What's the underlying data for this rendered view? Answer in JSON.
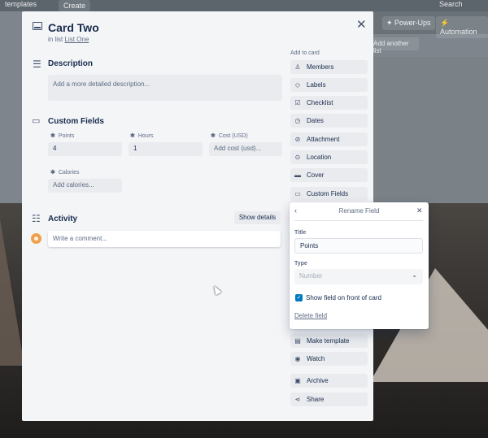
{
  "background": {
    "top_items": [
      "templates",
      "Create",
      "Search"
    ],
    "header_buttons": [
      "Power-Ups",
      "Automation"
    ],
    "add_list": "Add another list"
  },
  "card": {
    "title": "Card Two",
    "in_list_prefix": "in list",
    "list_name": "List One"
  },
  "description": {
    "title": "Description",
    "placeholder": "Add a more detailed description..."
  },
  "custom_fields": {
    "title": "Custom Fields",
    "fields": [
      {
        "label": "Points",
        "value": "4",
        "placeholder": false
      },
      {
        "label": "Hours",
        "value": "1",
        "placeholder": false
      },
      {
        "label": "Cost (USD)",
        "value": "Add cost (usd)...",
        "placeholder": true
      },
      {
        "label": "Calories",
        "value": "Add calories...",
        "placeholder": true
      }
    ]
  },
  "activity": {
    "title": "Activity",
    "show_details": "Show details",
    "comment_placeholder": "Write a comment..."
  },
  "sidebar": {
    "heading": "Add to card",
    "items": [
      {
        "label": "Members",
        "icon": "person-icon"
      },
      {
        "label": "Labels",
        "icon": "tag-icon"
      },
      {
        "label": "Checklist",
        "icon": "checklist-icon"
      },
      {
        "label": "Dates",
        "icon": "clock-icon"
      },
      {
        "label": "Attachment",
        "icon": "paperclip-icon"
      },
      {
        "label": "Location",
        "icon": "location-pin-icon"
      },
      {
        "label": "Cover",
        "icon": "cover-icon"
      },
      {
        "label": "Custom Fields",
        "icon": "custom-fields-icon"
      }
    ],
    "lower_items": [
      {
        "label": "Make template",
        "icon": "template-icon"
      },
      {
        "label": "Watch",
        "icon": "eye-icon"
      },
      {
        "label": "Archive",
        "icon": "archive-icon"
      },
      {
        "label": "Share",
        "icon": "share-icon"
      }
    ]
  },
  "popover": {
    "title": "Rename Field",
    "title_label": "Title",
    "title_value": "Points",
    "type_label": "Type",
    "type_value": "Number",
    "show_on_front_label": "Show field on front of card",
    "show_on_front_checked": true,
    "delete_label": "Delete field"
  },
  "colors": {
    "accent": "#0079bf",
    "modal_bg": "#f4f5f7",
    "text": "#172b4d"
  }
}
